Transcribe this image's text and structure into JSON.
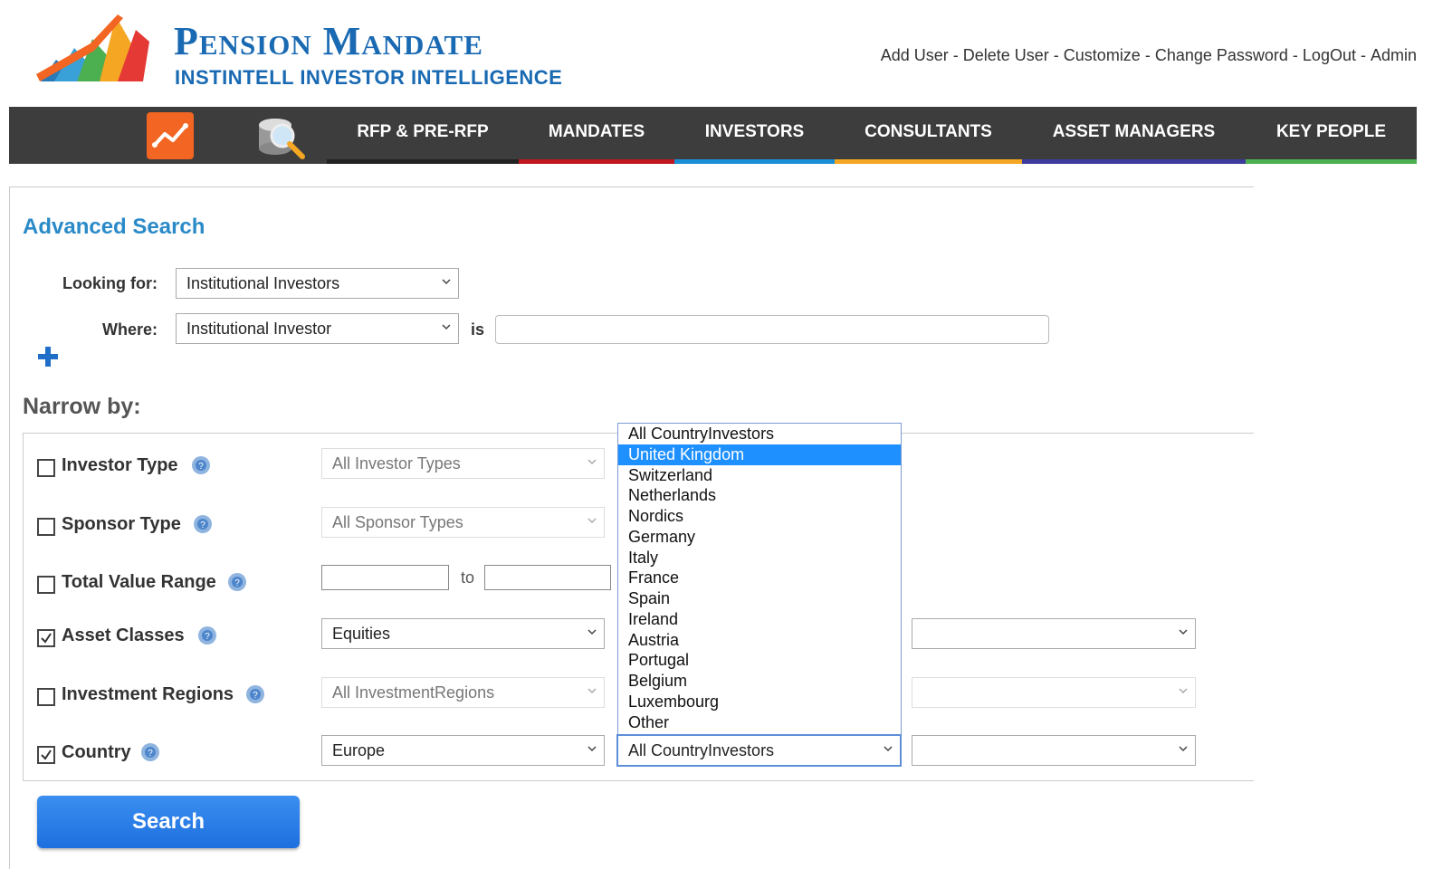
{
  "brand": {
    "title": "Pension Mandate",
    "subtitle": "INSTINTELL INVESTOR INTELLIGENCE"
  },
  "userlinks": [
    "Add User",
    "Delete User",
    "Customize",
    "Change Password",
    "LogOut",
    "Admin"
  ],
  "userlinks_separator": "-",
  "nav": {
    "items": [
      {
        "label": "RFP & PRE-RFP",
        "color": "#222222"
      },
      {
        "label": "MANDATES",
        "color": "#c0161d"
      },
      {
        "label": "INVESTORS",
        "color": "#1a8fd6"
      },
      {
        "label": "CONSULTANTS",
        "color": "#f5a623"
      },
      {
        "label": "ASSET MANAGERS",
        "color": "#3d3b9c"
      },
      {
        "label": "KEY PEOPLE",
        "color": "#4caf50"
      }
    ]
  },
  "advanced_search": {
    "title": "Advanced Search",
    "looking_for_label": "Looking for:",
    "looking_for_value": "Institutional Investors",
    "where_label": "Where:",
    "where_value": "Institutional Investor",
    "is_label": "is",
    "where_text": ""
  },
  "narrow": {
    "title": "Narrow by:",
    "rows": {
      "investor_type": {
        "label": "Investor Type",
        "checked": false,
        "select": "All Investor Types"
      },
      "sponsor_type": {
        "label": "Sponsor Type",
        "checked": false,
        "select": "All Sponsor Types"
      },
      "total_value": {
        "label": "Total Value Range",
        "checked": false,
        "to": "to"
      },
      "asset_classes": {
        "label": "Asset Classes",
        "checked": true,
        "select": "Equities",
        "select2": ""
      },
      "investment_regions": {
        "label": "Investment Regions",
        "checked": false,
        "select": "All InvestmentRegions",
        "select2": ""
      },
      "country": {
        "label": "Country",
        "checked": true,
        "select": "Europe",
        "select_country": "All CountryInvestors",
        "select2": ""
      }
    }
  },
  "country_dropdown": {
    "options": [
      "All CountryInvestors",
      "United Kingdom",
      "Switzerland",
      "Netherlands",
      "Nordics",
      "Germany",
      "Italy",
      "France",
      "Spain",
      "Ireland",
      "Austria",
      "Portugal",
      "Belgium",
      "Luxembourg",
      "Other"
    ],
    "highlighted": "United Kingdom"
  },
  "search_button": "Search"
}
